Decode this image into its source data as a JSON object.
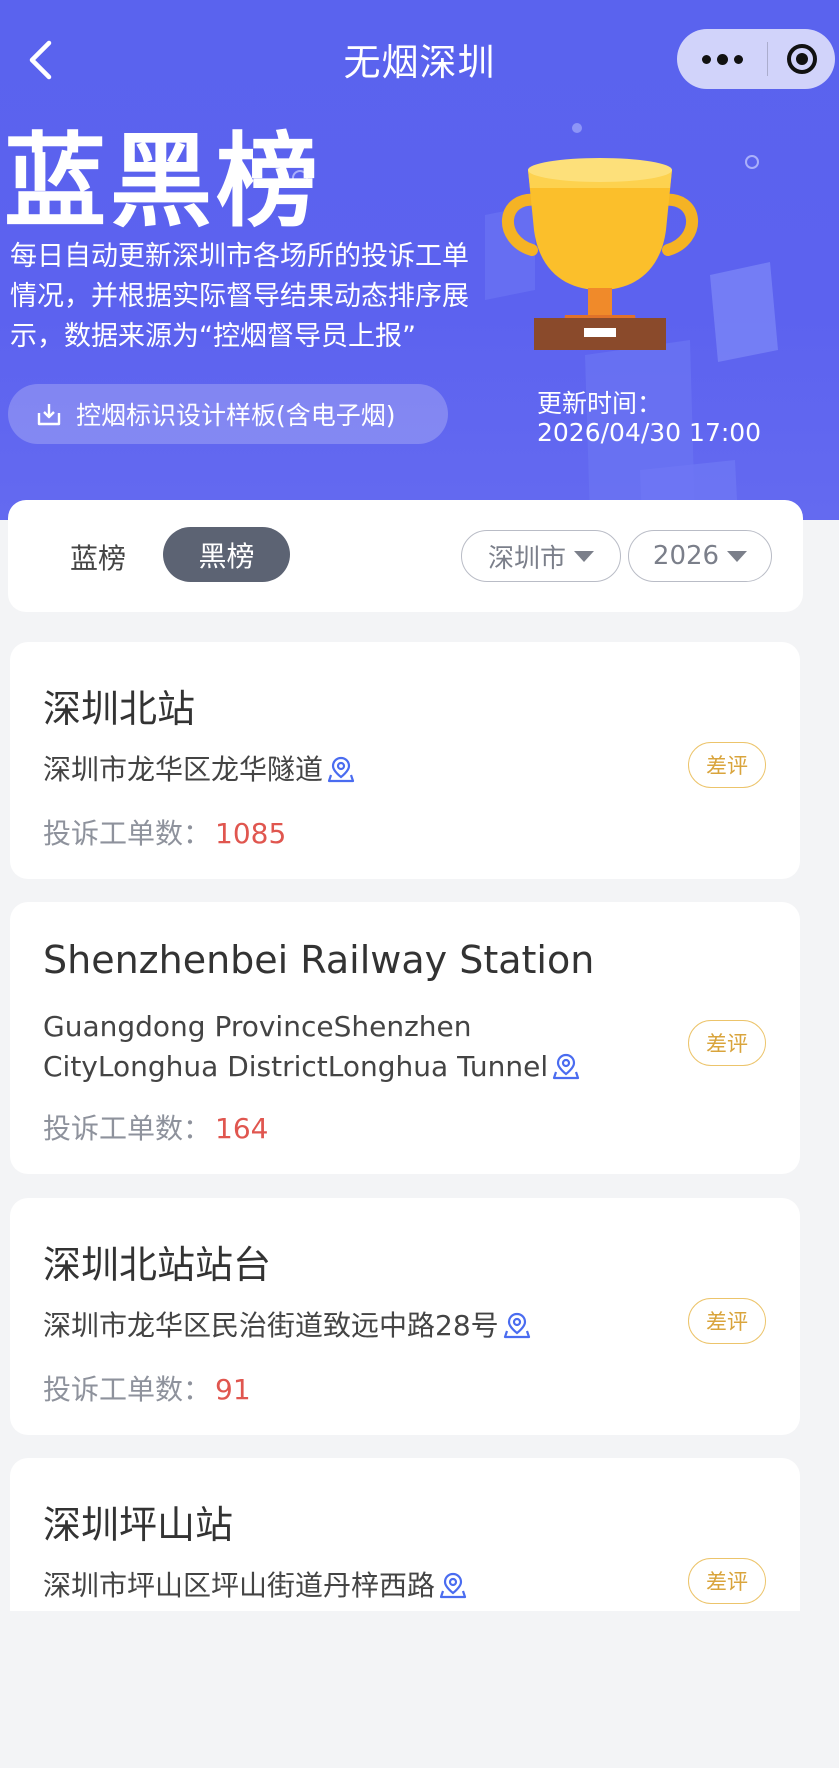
{
  "nav": {
    "title": "无烟深圳",
    "back_icon": "chevron-left-icon",
    "more_icon": "more-dots-icon",
    "close_icon": "target-icon"
  },
  "hero": {
    "title": "蓝黑榜",
    "intro_lines": [
      "每日自动更新深圳市各场所的投诉工单",
      "情况，并根据实际督导结果动态排序展",
      "示，数据来源为“控烟督导员上报”"
    ],
    "template_button": "控烟标识设计样板(含电子烟)",
    "template_icon": "download-icon",
    "update_label": "更新时间：",
    "update_time": "2026/04/30 17:00",
    "illustration": "trophy-icon"
  },
  "filters": {
    "tab_blue": "蓝榜",
    "tab_black": "黑榜",
    "active_tab": "黑榜",
    "city": "深圳市",
    "year": "2026"
  },
  "count_label": "投诉工单数：",
  "colors": {
    "primary": "#5a63ee",
    "active_tab_bg": "#5c6373",
    "count_value": "#e0564f",
    "badge": "#d9a43c"
  },
  "cards": [
    {
      "name": "深圳北站",
      "address_lines": [
        "深圳市龙华区龙华隧道"
      ],
      "count": "1085",
      "badge": "差评"
    },
    {
      "name": "Shenzhenbei Railway Station",
      "address_lines": [
        "Guangdong ProvinceShenzhen",
        "CityLonghua DistrictLonghua Tunnel"
      ],
      "count": "164",
      "badge": "差评"
    },
    {
      "name": "深圳北站站台",
      "address_lines": [
        "深圳市龙华区民治街道致远中路28号"
      ],
      "count": "91",
      "badge": "差评"
    },
    {
      "name": "深圳坪山站",
      "address_lines": [
        "深圳市坪山区坪山街道丹梓西路"
      ],
      "count": "",
      "badge": "差评"
    }
  ]
}
